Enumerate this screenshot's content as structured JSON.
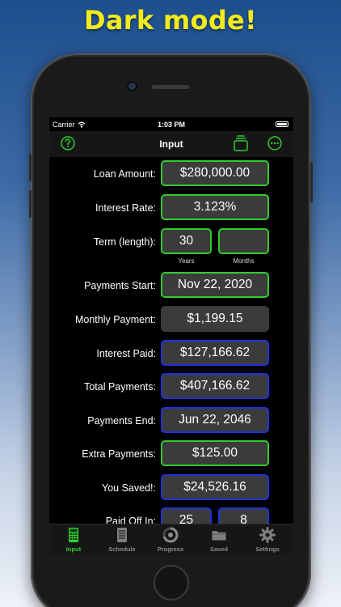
{
  "promo": {
    "headline": "Dark mode!"
  },
  "status_bar": {
    "carrier": "Carrier",
    "time": "1:03 PM"
  },
  "nav": {
    "title": "Input",
    "left_icon": "help-circle-icon",
    "right_icons": [
      "wallet-icon",
      "more-icon"
    ]
  },
  "form": {
    "loan_amount": {
      "label": "Loan Amount:",
      "value": "$280,000.00"
    },
    "interest_rate": {
      "label": "Interest Rate:",
      "value": "3.123%"
    },
    "term": {
      "label": "Term (length):",
      "years": "30",
      "months": "",
      "years_caption": "Years",
      "months_caption": "Months"
    },
    "payments_start": {
      "label": "Payments Start:",
      "value": "Nov 22, 2020"
    },
    "monthly_payment": {
      "label": "Monthly Payment:",
      "value": "$1,199.15"
    },
    "interest_paid": {
      "label": "Interest Paid:",
      "value": "$127,166.62"
    },
    "total_payments": {
      "label": "Total Payments:",
      "value": "$407,166.62"
    },
    "payments_end": {
      "label": "Payments End:",
      "value": "Jun 22, 2046"
    },
    "extra_payments": {
      "label": "Extra Payments:",
      "value": "$125.00"
    },
    "you_saved": {
      "label": "You Saved!:",
      "value": "$24,526.16"
    },
    "paid_off_in": {
      "label": "Paid Off In:",
      "years": "25",
      "months": "8"
    }
  },
  "tabs": [
    {
      "label": "Input",
      "icon": "calculator-icon",
      "active": true
    },
    {
      "label": "Schedule",
      "icon": "schedule-icon",
      "active": false
    },
    {
      "label": "Progress",
      "icon": "progress-icon",
      "active": false
    },
    {
      "label": "Saved",
      "icon": "folder-icon",
      "active": false
    },
    {
      "label": "Settings",
      "icon": "gear-icon",
      "active": false
    }
  ],
  "colors": {
    "input_border": "#2fcc2f",
    "output_border": "#2032d8",
    "field_bg": "#3b3b3b",
    "active_tab": "#2fcc2f"
  }
}
